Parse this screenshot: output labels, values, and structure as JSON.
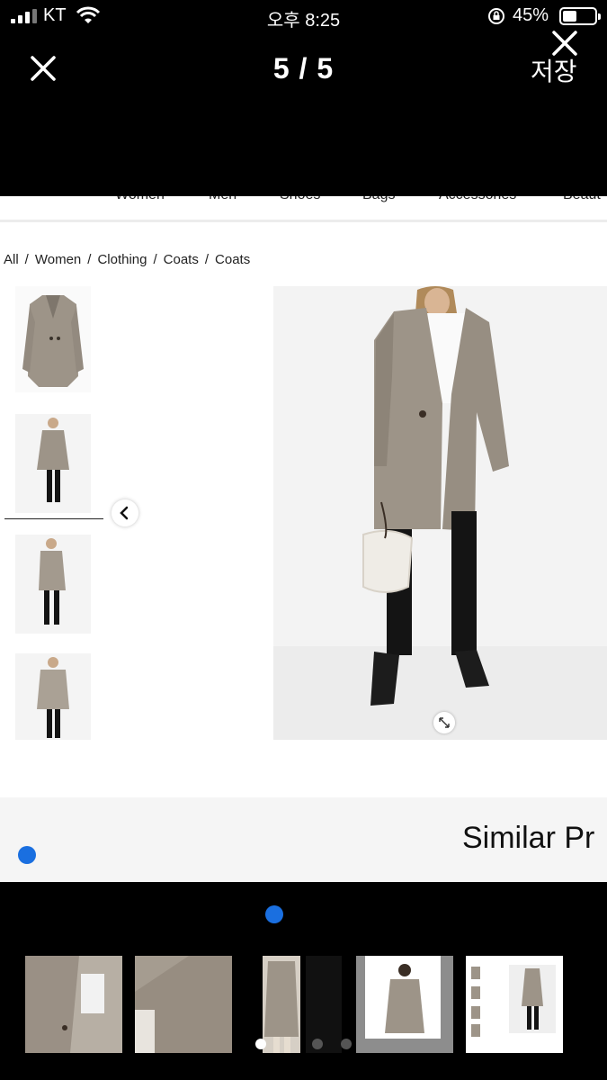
{
  "status_bar": {
    "carrier": "KT",
    "time": "오후 8:25",
    "battery_pct": "45%",
    "battery_level": 0.45
  },
  "viewer": {
    "counter": "5 / 5",
    "save_label": "저장"
  },
  "page": {
    "nav_items": [
      "Women",
      "Men",
      "Shoes",
      "Bags",
      "Accessories",
      "Beaut"
    ],
    "breadcrumb": [
      "All",
      "Women",
      "Clothing",
      "Coats",
      "Coats"
    ],
    "similar_heading": "Similar Pr"
  },
  "thumbnails": [
    {
      "icon": "coat-flat-photo"
    },
    {
      "icon": "model-front-photo",
      "selected": true
    },
    {
      "icon": "model-side-photo"
    },
    {
      "icon": "model-back-photo"
    }
  ],
  "filmstrip": [
    {
      "icon": "coat-closeup-photo"
    },
    {
      "icon": "fabric-closeup-photo"
    },
    {
      "icon": "coat-hanging-photo"
    },
    {
      "icon": "model-coat-photo"
    },
    {
      "icon": "product-page-photo",
      "selected": true
    }
  ],
  "colors": {
    "accent_blue": "#1a6fe0",
    "coat": "#9d9488",
    "background": "#000000"
  }
}
